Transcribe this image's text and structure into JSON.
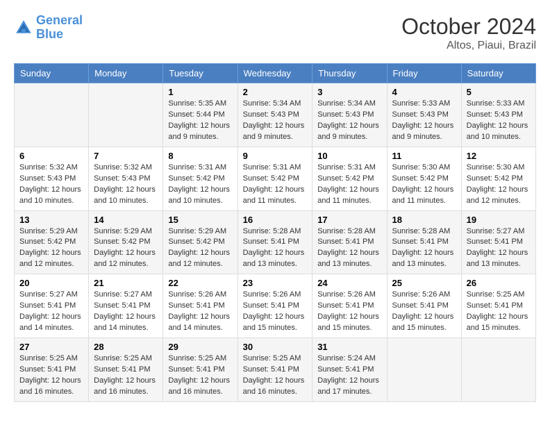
{
  "logo": {
    "line1": "General",
    "line2": "Blue"
  },
  "header": {
    "month": "October 2024",
    "location": "Altos, Piaui, Brazil"
  },
  "days_of_week": [
    "Sunday",
    "Monday",
    "Tuesday",
    "Wednesday",
    "Thursday",
    "Friday",
    "Saturday"
  ],
  "weeks": [
    [
      {
        "day": "",
        "sunrise": "",
        "sunset": "",
        "daylight": ""
      },
      {
        "day": "",
        "sunrise": "",
        "sunset": "",
        "daylight": ""
      },
      {
        "day": "1",
        "sunrise": "Sunrise: 5:35 AM",
        "sunset": "Sunset: 5:44 PM",
        "daylight": "Daylight: 12 hours and 9 minutes."
      },
      {
        "day": "2",
        "sunrise": "Sunrise: 5:34 AM",
        "sunset": "Sunset: 5:43 PM",
        "daylight": "Daylight: 12 hours and 9 minutes."
      },
      {
        "day": "3",
        "sunrise": "Sunrise: 5:34 AM",
        "sunset": "Sunset: 5:43 PM",
        "daylight": "Daylight: 12 hours and 9 minutes."
      },
      {
        "day": "4",
        "sunrise": "Sunrise: 5:33 AM",
        "sunset": "Sunset: 5:43 PM",
        "daylight": "Daylight: 12 hours and 9 minutes."
      },
      {
        "day": "5",
        "sunrise": "Sunrise: 5:33 AM",
        "sunset": "Sunset: 5:43 PM",
        "daylight": "Daylight: 12 hours and 10 minutes."
      }
    ],
    [
      {
        "day": "6",
        "sunrise": "Sunrise: 5:32 AM",
        "sunset": "Sunset: 5:43 PM",
        "daylight": "Daylight: 12 hours and 10 minutes."
      },
      {
        "day": "7",
        "sunrise": "Sunrise: 5:32 AM",
        "sunset": "Sunset: 5:43 PM",
        "daylight": "Daylight: 12 hours and 10 minutes."
      },
      {
        "day": "8",
        "sunrise": "Sunrise: 5:31 AM",
        "sunset": "Sunset: 5:42 PM",
        "daylight": "Daylight: 12 hours and 10 minutes."
      },
      {
        "day": "9",
        "sunrise": "Sunrise: 5:31 AM",
        "sunset": "Sunset: 5:42 PM",
        "daylight": "Daylight: 12 hours and 11 minutes."
      },
      {
        "day": "10",
        "sunrise": "Sunrise: 5:31 AM",
        "sunset": "Sunset: 5:42 PM",
        "daylight": "Daylight: 12 hours and 11 minutes."
      },
      {
        "day": "11",
        "sunrise": "Sunrise: 5:30 AM",
        "sunset": "Sunset: 5:42 PM",
        "daylight": "Daylight: 12 hours and 11 minutes."
      },
      {
        "day": "12",
        "sunrise": "Sunrise: 5:30 AM",
        "sunset": "Sunset: 5:42 PM",
        "daylight": "Daylight: 12 hours and 12 minutes."
      }
    ],
    [
      {
        "day": "13",
        "sunrise": "Sunrise: 5:29 AM",
        "sunset": "Sunset: 5:42 PM",
        "daylight": "Daylight: 12 hours and 12 minutes."
      },
      {
        "day": "14",
        "sunrise": "Sunrise: 5:29 AM",
        "sunset": "Sunset: 5:42 PM",
        "daylight": "Daylight: 12 hours and 12 minutes."
      },
      {
        "day": "15",
        "sunrise": "Sunrise: 5:29 AM",
        "sunset": "Sunset: 5:42 PM",
        "daylight": "Daylight: 12 hours and 12 minutes."
      },
      {
        "day": "16",
        "sunrise": "Sunrise: 5:28 AM",
        "sunset": "Sunset: 5:41 PM",
        "daylight": "Daylight: 12 hours and 13 minutes."
      },
      {
        "day": "17",
        "sunrise": "Sunrise: 5:28 AM",
        "sunset": "Sunset: 5:41 PM",
        "daylight": "Daylight: 12 hours and 13 minutes."
      },
      {
        "day": "18",
        "sunrise": "Sunrise: 5:28 AM",
        "sunset": "Sunset: 5:41 PM",
        "daylight": "Daylight: 12 hours and 13 minutes."
      },
      {
        "day": "19",
        "sunrise": "Sunrise: 5:27 AM",
        "sunset": "Sunset: 5:41 PM",
        "daylight": "Daylight: 12 hours and 13 minutes."
      }
    ],
    [
      {
        "day": "20",
        "sunrise": "Sunrise: 5:27 AM",
        "sunset": "Sunset: 5:41 PM",
        "daylight": "Daylight: 12 hours and 14 minutes."
      },
      {
        "day": "21",
        "sunrise": "Sunrise: 5:27 AM",
        "sunset": "Sunset: 5:41 PM",
        "daylight": "Daylight: 12 hours and 14 minutes."
      },
      {
        "day": "22",
        "sunrise": "Sunrise: 5:26 AM",
        "sunset": "Sunset: 5:41 PM",
        "daylight": "Daylight: 12 hours and 14 minutes."
      },
      {
        "day": "23",
        "sunrise": "Sunrise: 5:26 AM",
        "sunset": "Sunset: 5:41 PM",
        "daylight": "Daylight: 12 hours and 15 minutes."
      },
      {
        "day": "24",
        "sunrise": "Sunrise: 5:26 AM",
        "sunset": "Sunset: 5:41 PM",
        "daylight": "Daylight: 12 hours and 15 minutes."
      },
      {
        "day": "25",
        "sunrise": "Sunrise: 5:26 AM",
        "sunset": "Sunset: 5:41 PM",
        "daylight": "Daylight: 12 hours and 15 minutes."
      },
      {
        "day": "26",
        "sunrise": "Sunrise: 5:25 AM",
        "sunset": "Sunset: 5:41 PM",
        "daylight": "Daylight: 12 hours and 15 minutes."
      }
    ],
    [
      {
        "day": "27",
        "sunrise": "Sunrise: 5:25 AM",
        "sunset": "Sunset: 5:41 PM",
        "daylight": "Daylight: 12 hours and 16 minutes."
      },
      {
        "day": "28",
        "sunrise": "Sunrise: 5:25 AM",
        "sunset": "Sunset: 5:41 PM",
        "daylight": "Daylight: 12 hours and 16 minutes."
      },
      {
        "day": "29",
        "sunrise": "Sunrise: 5:25 AM",
        "sunset": "Sunset: 5:41 PM",
        "daylight": "Daylight: 12 hours and 16 minutes."
      },
      {
        "day": "30",
        "sunrise": "Sunrise: 5:25 AM",
        "sunset": "Sunset: 5:41 PM",
        "daylight": "Daylight: 12 hours and 16 minutes."
      },
      {
        "day": "31",
        "sunrise": "Sunrise: 5:24 AM",
        "sunset": "Sunset: 5:41 PM",
        "daylight": "Daylight: 12 hours and 17 minutes."
      },
      {
        "day": "",
        "sunrise": "",
        "sunset": "",
        "daylight": ""
      },
      {
        "day": "",
        "sunrise": "",
        "sunset": "",
        "daylight": ""
      }
    ]
  ]
}
